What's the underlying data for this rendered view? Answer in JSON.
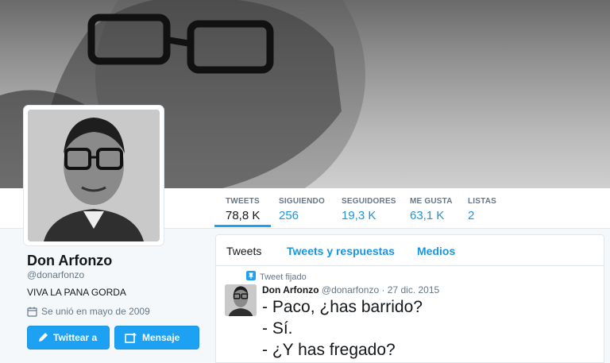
{
  "banner": {
    "description": ""
  },
  "profile": {
    "name": "Don Arfonzo",
    "handle": "@donarfonzo",
    "bio": "VIVA LA PANA GORDA",
    "joined": "Se unió en mayo de 2009",
    "tweet_to_label": "Twittear a",
    "message_label": "Mensaje"
  },
  "stats": [
    {
      "label": "TWEETS",
      "value": "78,8 K"
    },
    {
      "label": "SIGUIENDO",
      "value": "256"
    },
    {
      "label": "SEGUIDORES",
      "value": "19,3 K"
    },
    {
      "label": "ME GUSTA",
      "value": "63,1 K"
    },
    {
      "label": "LISTAS",
      "value": "2"
    }
  ],
  "tabs": [
    {
      "label": "Tweets"
    },
    {
      "label": "Tweets y respuestas"
    },
    {
      "label": "Medios"
    }
  ],
  "tweet": {
    "pinned_label": "Tweet fijado",
    "author": "Don Arfonzo",
    "handle": "@donarfonzo",
    "date": "· 27 dic. 2015",
    "lines": [
      "- Paco, ¿has barrido?",
      "- Sí.",
      "- ¿Y has fregado?"
    ]
  },
  "colors": {
    "accent": "#1da1f2",
    "link": "#1b95e0"
  }
}
